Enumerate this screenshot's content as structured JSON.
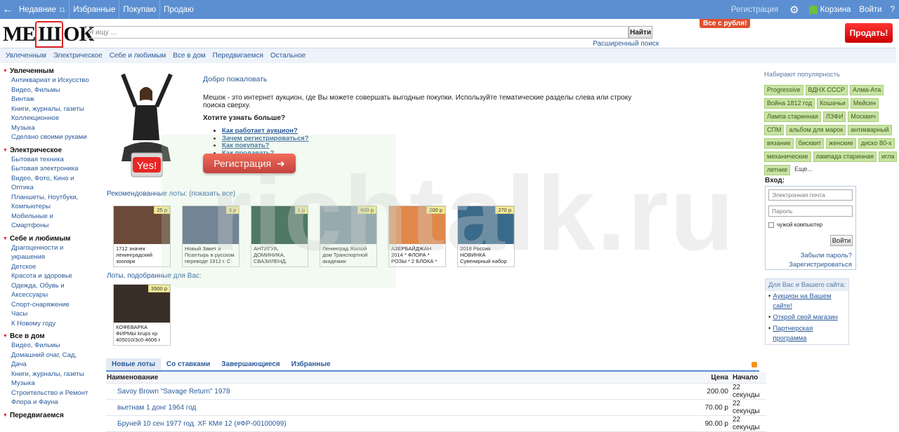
{
  "topbar": {
    "nav": [
      {
        "label": "Недавние",
        "count": "11"
      },
      {
        "label": "Избранные"
      },
      {
        "label": "Покупаю"
      },
      {
        "label": "Продаю"
      }
    ],
    "register": "Регистрация",
    "cart": "Корзина",
    "login": "Войти",
    "help": "?"
  },
  "header": {
    "logo": "МЕШОК",
    "search_placeholder": "Я ищу ...",
    "search_button": "Найти",
    "advanced_search": "Расширенный поиск",
    "promo": "Все с рубля!",
    "sell_button": "Продать!"
  },
  "catbar": [
    "Увлеченным",
    "Электрическое",
    "Себе и любимым",
    "Все в дом",
    "Передвигаемся",
    "Остальное"
  ],
  "sidebar": [
    {
      "title": "Увлеченным",
      "items": [
        "Антиквариат и Искусство",
        "Видео, Фильмы",
        "Винтаж",
        "Книги, журналы, газеты",
        "Коллекционное",
        "Музыка",
        "Сделано своими руками"
      ]
    },
    {
      "title": "Электрическое",
      "items": [
        "Бытовая техника",
        "Бытовая электроника",
        "Видео, Фото, Кино и",
        "Оптика",
        "Планшеты, Ноутбуки,",
        "Компьютеры",
        "Мобильные и",
        "Смартфоны"
      ]
    },
    {
      "title": "Себе и любимым",
      "items": [
        "Драгоценности и",
        "украшения",
        "Детское",
        "Красота и здоровье",
        "Одежда, Обувь и",
        "Аксессуары",
        "Спорт-снаряжение",
        "Часы",
        "К Новому году"
      ]
    },
    {
      "title": "Все в дом",
      "items": [
        "Видео, Фильмы",
        "Домашний очаг, Сад,",
        "Дача",
        "Книги, журналы, газеты",
        "Музыка",
        "Строительство и Ремонт",
        "Флора и Фауна"
      ]
    },
    {
      "title": "Передвигаемся",
      "items": []
    }
  ],
  "welcome": {
    "hello": "Добро пожаловать",
    "desc": "Мешок - это интернет аукцион, где Вы можете совершать выгодные покупки. Используйте тематические разделы слева или строку поиска сверху.",
    "more": "Хотите узнать больше?",
    "links": [
      "Как работает аукцион?",
      "Зачем регистрироваться?",
      "Как покупать?",
      "Как продавать?"
    ],
    "register_button": "Регистрация",
    "yes": "Yes!"
  },
  "recommended_title": "Рекомендованные лоты: (показать все)",
  "recommended": [
    {
      "price": "25 р",
      "title": "1712 значек ленинградский зоопарк",
      "color": "#6b4a3a"
    },
    {
      "price": "3 р",
      "title": "Новый Завет и Псалтырь в русском переводе 1912 г. С",
      "color": "#5b6a88"
    },
    {
      "price": "1 р",
      "title": "АНТИГУА, ДОМИНИКА, СВАЗИЛЕНД.",
      "color": "#2f5a4a"
    },
    {
      "price": "600 р",
      "title": "Ленинград Жилой дом Транспортной академии",
      "color": "#8a9aa8"
    },
    {
      "price": "200 р",
      "title": "АЗЕРБАЙДЖАН 2014 * ФЛОРА * РОЗЫ * 2 БЛОКА *",
      "color": "#e0884a"
    },
    {
      "price": "270 р",
      "title": "2018 Россия НОВИНКА Сувенирный набор",
      "color": "#3a6a8a"
    }
  ],
  "picked_title": "Лоты, подобранные для Вас:",
  "picked": [
    {
      "price": "3500 р",
      "title": "КОФЕВАРКА ФИРМЫ krups xp 405010/3c0-4606 г",
      "color": "#3a2e28"
    }
  ],
  "tabs": [
    "Новые лоты",
    "Со ставками",
    "Завершающиеся",
    "Избранные"
  ],
  "table": {
    "headers": {
      "name": "Наименование",
      "price": "Цена",
      "start": "Начало"
    },
    "rows": [
      {
        "name": "Savoy Brown \"Savage Return\" 1978",
        "price": "200.00",
        "start": "22 секунды"
      },
      {
        "name": "вьетнам 1 донг 1964 год",
        "price": "70.00 р",
        "start": "22 секунды"
      },
      {
        "name": "Бруней 10 сен 1977 год. XF КМ# 12 (#ФР-00100099)",
        "price": "90.00 р",
        "start": "22 секунды"
      }
    ]
  },
  "popular": {
    "title": "Набирают популярность",
    "tags": [
      "Progressive",
      "ВДНХ СССР",
      "Алма-Ата",
      "Война 1812 год",
      "Кошачьи",
      "Мейсен",
      "Лампа старинная",
      "ЛЗФИ",
      "Москвич",
      "СПМ",
      "альбом для марок",
      "антикварный",
      "вязание",
      "бисквит",
      "женские",
      "диско 80-х",
      "механические",
      "лампада старинная",
      "игла",
      "летние"
    ],
    "more": "Еще..."
  },
  "login": {
    "title": "Вход:",
    "email_placeholder": "Электронная почта",
    "password_placeholder": "Пароль",
    "foreign": "чужой компьютер",
    "button": "Войти",
    "forgot": "Забыли пароль?",
    "register": "Зарегистрироваться"
  },
  "site": {
    "title": "Для Вас и Вашего сайта:",
    "items": [
      "Аукцион на Вашем сайте!",
      "Открой свой магазин",
      "Партнерская программа"
    ]
  },
  "watermark": "richtalk.ru"
}
